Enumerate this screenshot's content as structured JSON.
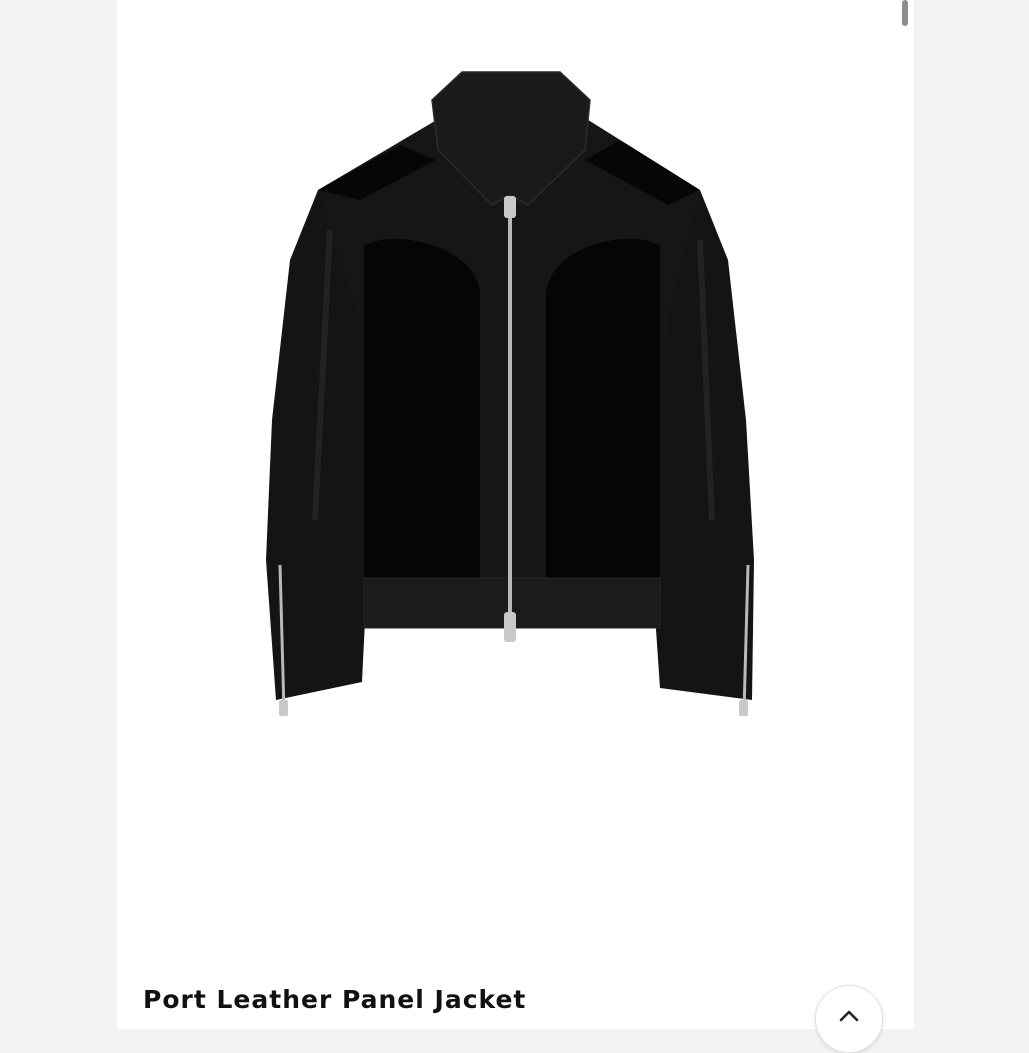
{
  "product": {
    "title": "Port Leather Panel Jacket",
    "image": "black leather jacket with suede panels and zip front"
  },
  "controls": {
    "scroll_top_icon": "chevron-up-icon"
  },
  "colors": {
    "leather": "#141414",
    "suede": "#050505",
    "zipper": "#b9b9b9",
    "background": "#f2f3f5",
    "page": "#ffffff"
  }
}
